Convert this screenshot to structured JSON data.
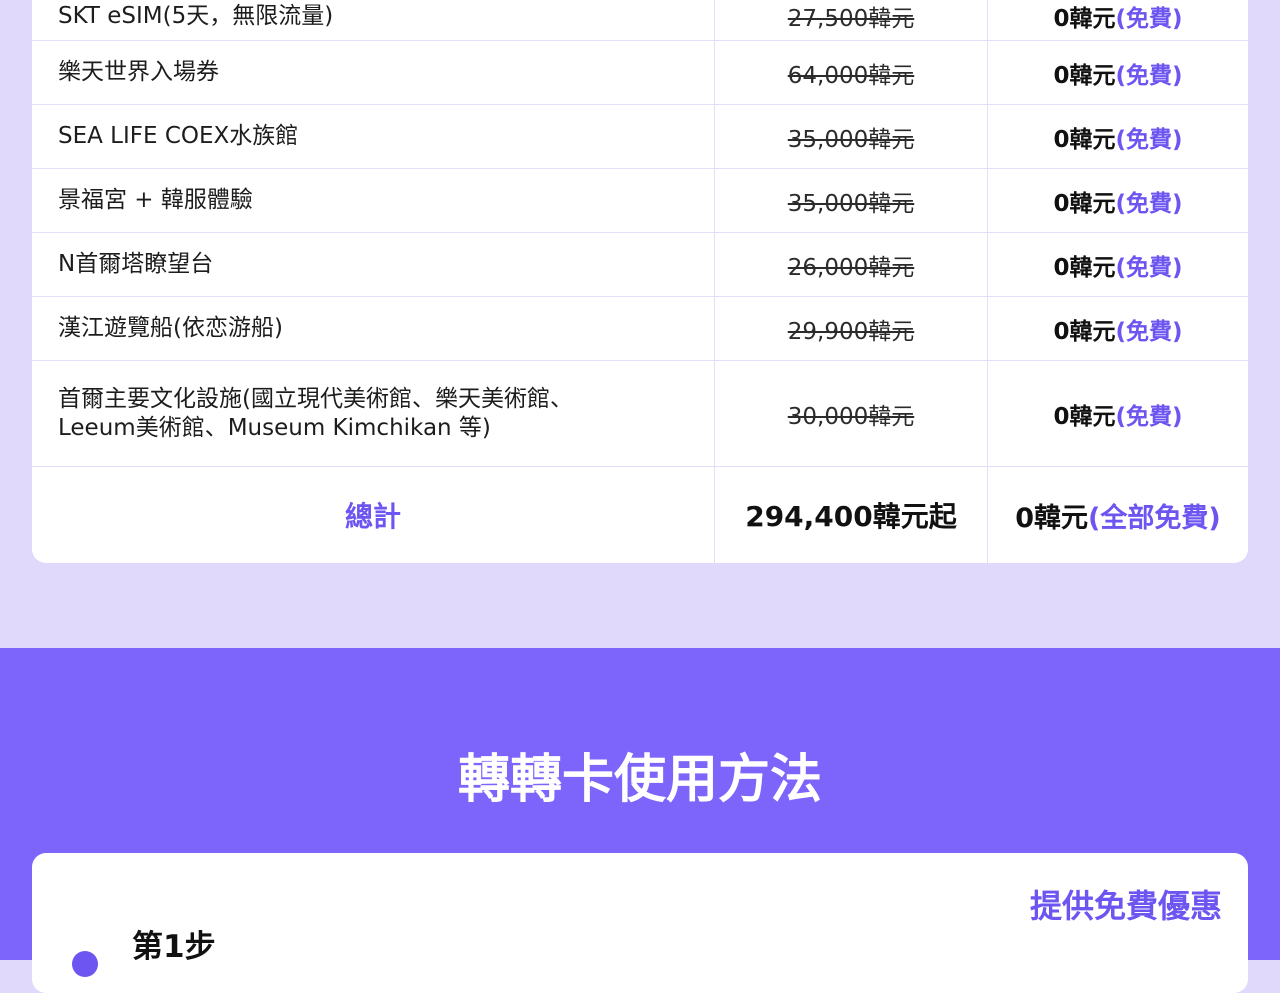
{
  "price_table": {
    "rows": [
      {
        "item": "SKT eSIM(5天，無限流量)",
        "original": "27,500韓元",
        "price": "0韓元",
        "free": "(免費)"
      },
      {
        "item": "樂天世界入場券",
        "original": "64,000韓元",
        "price": "0韓元",
        "free": "(免費)"
      },
      {
        "item": "SEA LIFE COEX水族館",
        "original": "35,000韓元",
        "price": "0韓元",
        "free": "(免費)"
      },
      {
        "item": "景福宮 + 韓服體驗",
        "original": "35,000韓元",
        "price": "0韓元",
        "free": "(免費)"
      },
      {
        "item": "N首爾塔瞭望台",
        "original": "26,000韓元",
        "price": "0韓元",
        "free": "(免費)"
      },
      {
        "item": "漢江遊覽船(依恋游船)",
        "original": "29,900韓元",
        "price": "0韓元",
        "free": "(免費)"
      },
      {
        "item_line1": "首爾主要文化設施(國立現代美術館、樂天美術館、",
        "item_line2": "Leeum美術館、Museum Kimchikan 等)",
        "original": "30,000韓元",
        "price": "0韓元",
        "free": "(免費)"
      }
    ],
    "total": {
      "label": "總計",
      "original": "294,400韓元起",
      "price": "0韓元",
      "free": "(全部免費)"
    }
  },
  "usage": {
    "title": "轉轉卡使用方法",
    "promo_tag": "提供免費優惠",
    "step_label": "第1步"
  },
  "colors": {
    "accent": "#6c55f0",
    "section_bg": "#7d64fb",
    "page_bg": "#e0d9fb"
  }
}
